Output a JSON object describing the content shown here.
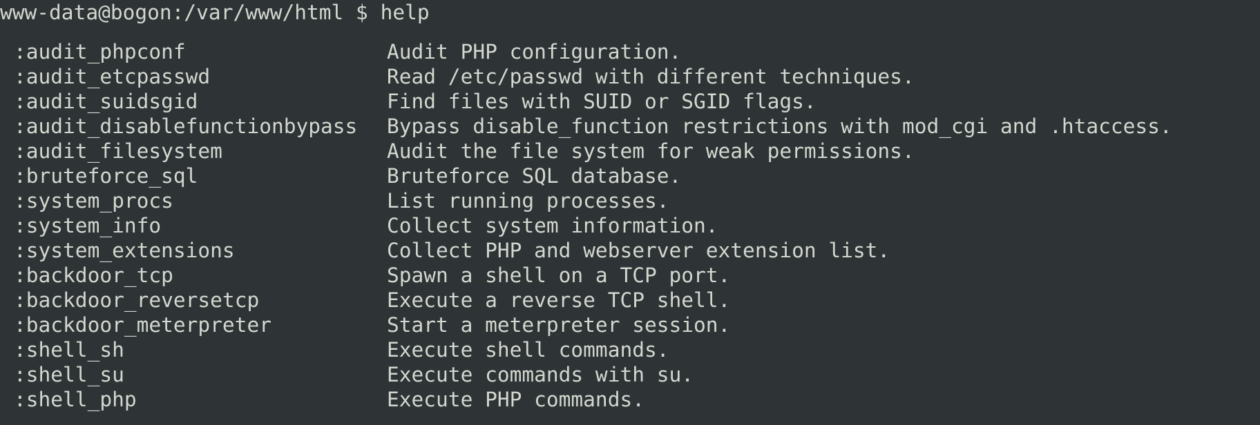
{
  "prompt": {
    "user_host_path": "www-data@bogon:/var/www/html $ ",
    "command": "help"
  },
  "commands": [
    {
      "name": ":audit_phpconf",
      "description": "Audit PHP configuration."
    },
    {
      "name": ":audit_etcpasswd",
      "description": "Read /etc/passwd with different techniques."
    },
    {
      "name": ":audit_suidsgid",
      "description": "Find files with SUID or SGID flags."
    },
    {
      "name": ":audit_disablefunctionbypass",
      "description": "Bypass disable_function restrictions with mod_cgi and .htaccess."
    },
    {
      "name": ":audit_filesystem",
      "description": "Audit the file system for weak permissions."
    },
    {
      "name": ":bruteforce_sql",
      "description": "Bruteforce SQL database."
    },
    {
      "name": ":system_procs",
      "description": "List running processes."
    },
    {
      "name": ":system_info",
      "description": "Collect system information."
    },
    {
      "name": ":system_extensions",
      "description": "Collect PHP and webserver extension list."
    },
    {
      "name": ":backdoor_tcp",
      "description": "Spawn a shell on a TCP port."
    },
    {
      "name": ":backdoor_reversetcp",
      "description": "Execute a reverse TCP shell."
    },
    {
      "name": ":backdoor_meterpreter",
      "description": "Start a meterpreter session."
    },
    {
      "name": ":shell_sh",
      "description": "Execute shell commands."
    },
    {
      "name": ":shell_su",
      "description": "Execute commands with su."
    },
    {
      "name": ":shell_php",
      "description": "Execute PHP commands."
    }
  ],
  "colors": {
    "background": "#2e3436",
    "foreground": "#d3d7cf"
  }
}
